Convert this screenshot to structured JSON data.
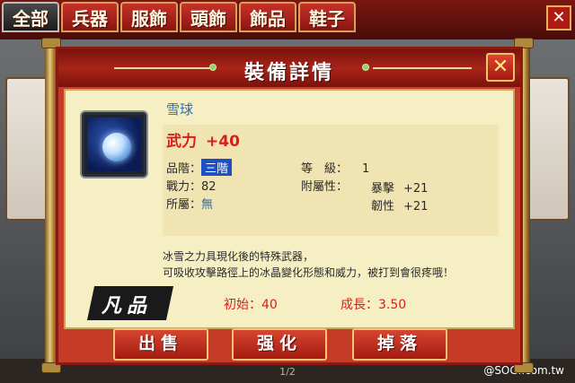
{
  "tabs": [
    "全部",
    "兵器",
    "服飾",
    "頭飾",
    "飾品",
    "鞋子"
  ],
  "page_indicator": "1/2",
  "watermark": "@SOGI.com.tw",
  "dialog": {
    "title": "裝備詳情",
    "close_icon": "close-icon"
  },
  "item": {
    "name": "雪球",
    "icon": "snowball-icon",
    "attack_label": "武力",
    "attack_value": "+40",
    "tier_label": "品階：",
    "tier_value": "三階",
    "power_label": "戰力：",
    "power_value": "82",
    "owner_label": "所屬：",
    "owner_value": "無",
    "level_label": "等　級：",
    "level_value": "1",
    "attr_label": "附屬性：",
    "attrs": [
      {
        "name": "暴擊",
        "value": "+21"
      },
      {
        "name": "韌性",
        "value": "+21"
      }
    ],
    "description": [
      "冰雪之力具現化後的特殊武器，",
      "可吸收攻擊路徑上的冰晶變化形態和威力，被打到會很疼哦！"
    ],
    "grade": "凡品",
    "initial": "初始：40",
    "growth": "成長：3.50"
  },
  "buttons": {
    "sell": "出售",
    "enhance": "强化",
    "drop": "掉落"
  },
  "colors": {
    "frame_red": "#c63b27",
    "panel": "#f6efc4",
    "accent_blue": "#1d4fc7",
    "stat_red": "#d8201a"
  }
}
